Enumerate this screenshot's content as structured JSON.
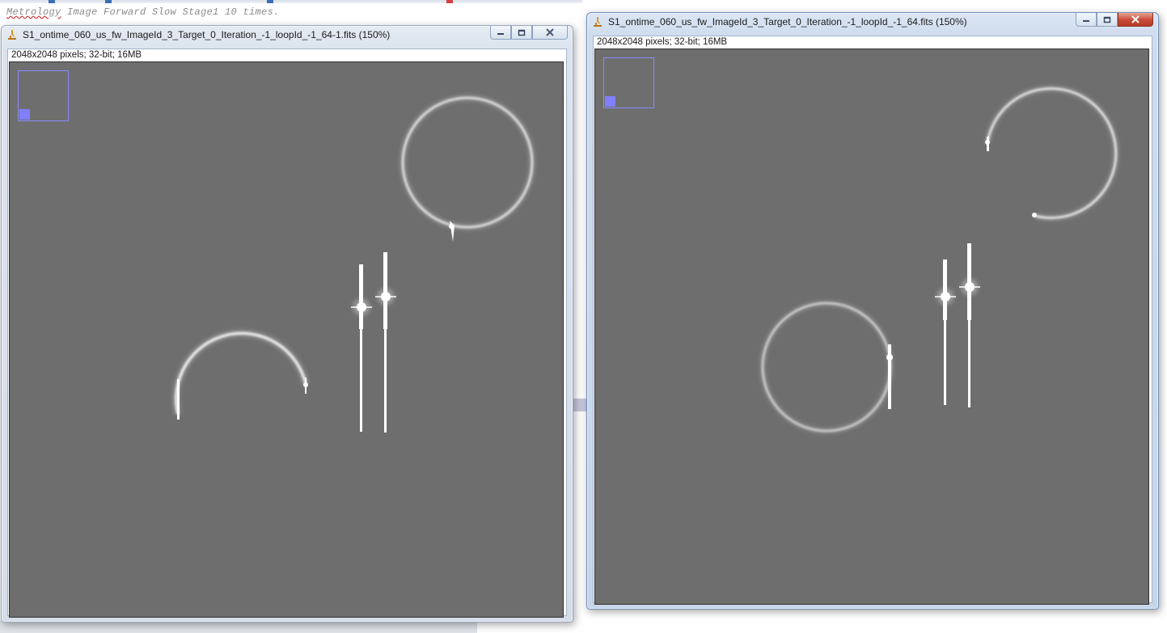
{
  "background": {
    "console_line": "Metrology Image Forward Slow Stage1 10 times.",
    "console_line_misspelled_word": "Metrology",
    "colors": {
      "console_text": "#8a8a8a"
    }
  },
  "windows": [
    {
      "title": "S1_ontime_060_us_fw_ImageId_3_Target_0_Iteration_-1_loopId_-1_64-1.fits (150%)",
      "info": "2048x2048 pixels; 32-bit; 16MB",
      "state": "inactive",
      "controls": [
        "minimize-icon",
        "maximize-icon",
        "close-icon"
      ]
    },
    {
      "title": "S1_ontime_060_us_fw_ImageId_3_Target_0_Iteration_-1_loopId_-1_64.fits (150%)",
      "info": "2048x2048 pixels; 32-bit; 16MB",
      "state": "active",
      "controls": [
        "minimize-icon",
        "maximize-icon",
        "close-icon"
      ]
    }
  ],
  "colors": {
    "image_background": "#6e6e6e",
    "navigator_outline": "#8a8aff",
    "navigator_view": "#8080ff",
    "feature_white": "#ffffff"
  }
}
